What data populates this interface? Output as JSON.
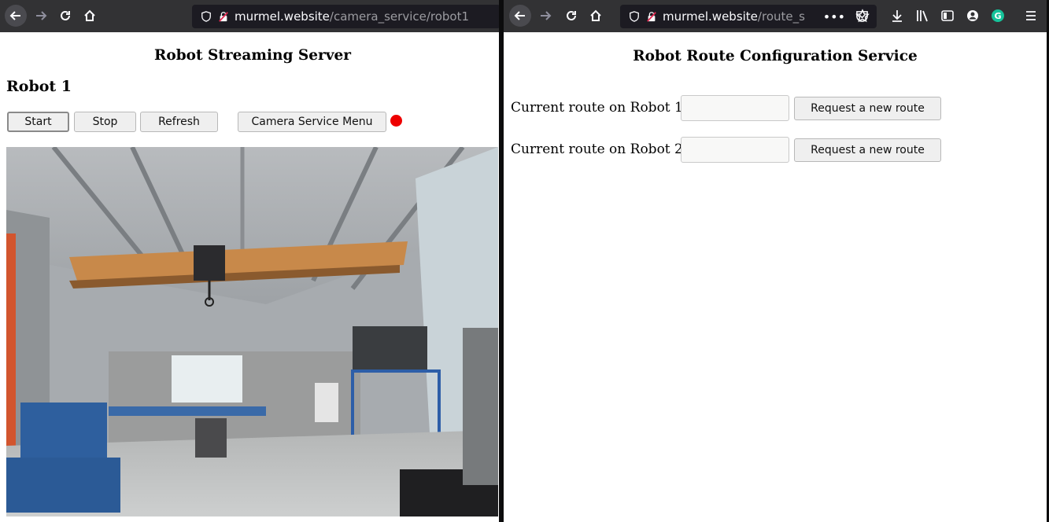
{
  "left_window": {
    "url": {
      "host": "murmel.website",
      "path": "/camera_service/robot1"
    },
    "page": {
      "title": "Robot Streaming Server",
      "robot_heading": "Robot 1",
      "buttons": {
        "start": "Start",
        "stop": "Stop",
        "refresh": "Refresh",
        "menu": "Camera Service Menu"
      },
      "status_color": "#ee0000"
    }
  },
  "right_window": {
    "url": {
      "host": "murmel.website",
      "path": "/route_s"
    },
    "page": {
      "title": "Robot Route Configuration Service",
      "rows": [
        {
          "label": "Current route on Robot 1:",
          "value": "",
          "button": "Request a new route"
        },
        {
          "label": "Current route on Robot 2:",
          "value": "",
          "button": "Request a new route"
        }
      ]
    }
  }
}
